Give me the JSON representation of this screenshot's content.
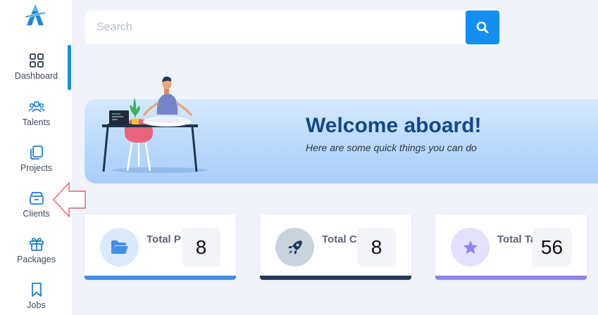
{
  "sidebar": {
    "items": [
      {
        "label": "Dashboard",
        "icon": "grid-icon"
      },
      {
        "label": "Talents",
        "icon": "users-icon"
      },
      {
        "label": "Projects",
        "icon": "copy-icon"
      },
      {
        "label": "Clients",
        "icon": "archive-icon"
      },
      {
        "label": "Packages",
        "icon": "gift-icon"
      },
      {
        "label": "Jobs",
        "icon": "bookmark-icon"
      }
    ],
    "active": "Dashboard",
    "accent_color": "#1a8fe3"
  },
  "search": {
    "placeholder": "Search",
    "value": ""
  },
  "banner": {
    "title": "Welcome aboard!",
    "subtitle": "Here are some quick things you can do"
  },
  "cards": [
    {
      "label": "Total Projects",
      "count": "8",
      "icon": "folder-icon",
      "color": "#3f8ee8"
    },
    {
      "label": "Total Clients",
      "count": "8",
      "icon": "rocket-icon",
      "color": "#1f3a5c"
    },
    {
      "label": "Total Talents",
      "count": "56",
      "icon": "star-icon",
      "color": "#8c85ee"
    }
  ]
}
